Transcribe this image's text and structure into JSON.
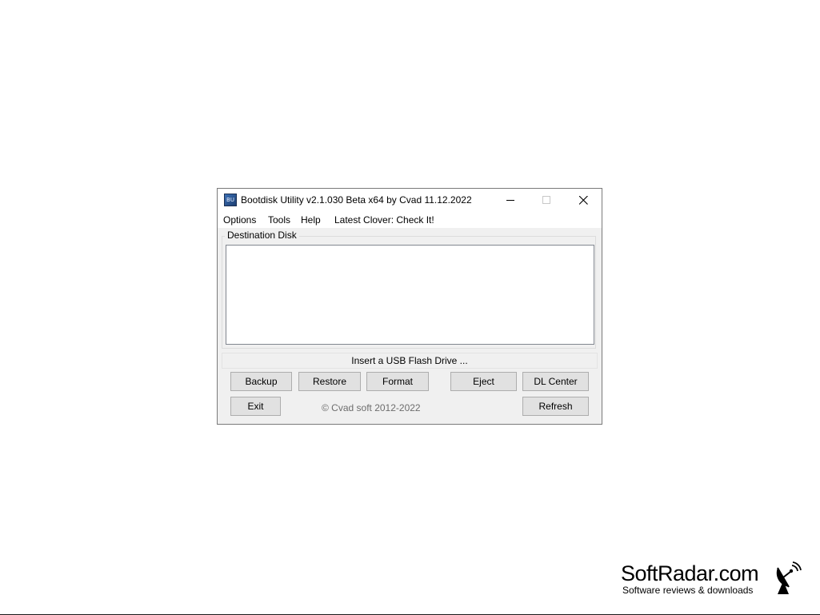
{
  "window": {
    "title": "Bootdisk Utility v2.1.030 Beta x64 by Cvad 11.12.2022",
    "icon_name": "bootdisk-app-icon",
    "icon_text": "BU"
  },
  "menu": {
    "items": [
      "Options",
      "Tools",
      "Help",
      "Latest Clover: Check It!"
    ]
  },
  "destination": {
    "label": "Destination Disk"
  },
  "status": {
    "text": "Insert a USB Flash Drive ..."
  },
  "buttons": {
    "backup": "Backup",
    "restore": "Restore",
    "format": "Format",
    "eject": "Eject",
    "dl_center": "DL Center",
    "exit": "Exit",
    "refresh": "Refresh"
  },
  "footer": {
    "copyright": "© Cvad soft 2012-2022"
  },
  "watermark": {
    "name": "SoftRadar.com",
    "tagline": "Software reviews & downloads",
    "icon_name": "satellite-dish-icon"
  },
  "colors": {
    "window_bg": "#f0f0f0",
    "button_bg": "#e1e1e1",
    "button_border": "#adadad",
    "copyright_text": "#6d6d6d"
  }
}
